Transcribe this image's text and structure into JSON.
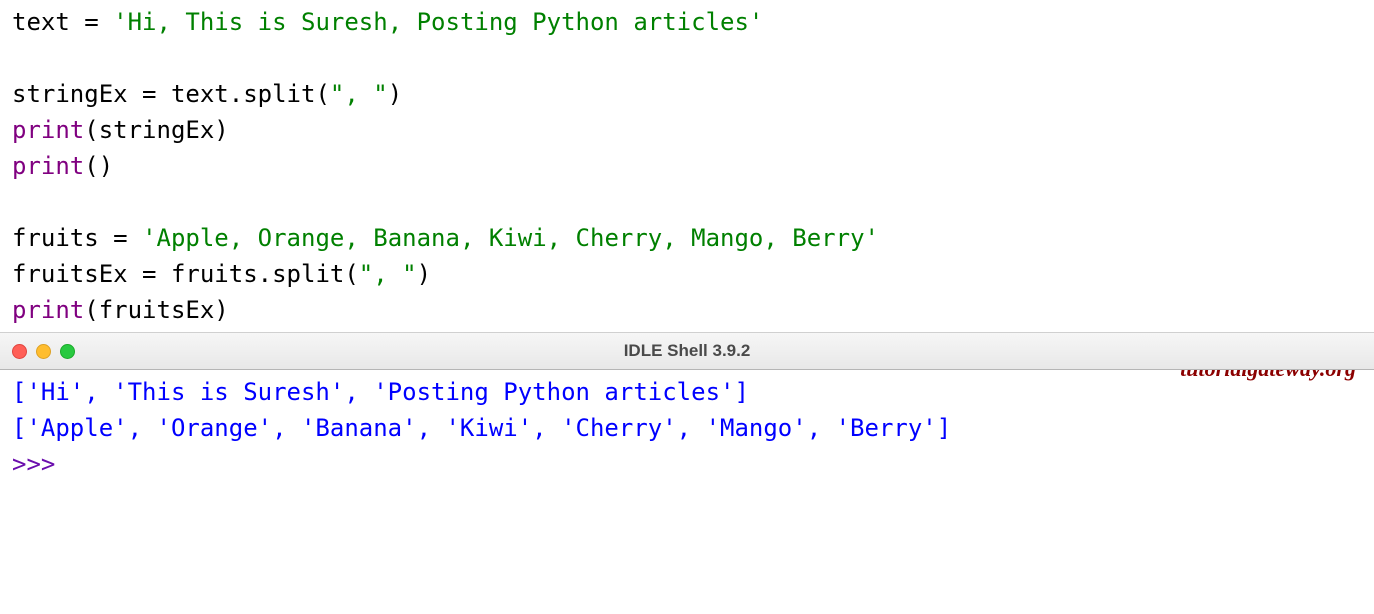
{
  "editor": {
    "line1": {
      "var": "text",
      "eq": " = ",
      "str": "'Hi, This is Suresh, Posting Python articles'"
    },
    "line3": {
      "var": "stringEx",
      "eq": " = ",
      "attr": "text.split(",
      "arg": "\", \"",
      "close": ")"
    },
    "line4": {
      "fn": "print",
      "open": "(",
      "arg": "stringEx",
      "close": ")"
    },
    "line5": {
      "fn": "print",
      "parens": "()"
    },
    "line7": {
      "var": "fruits",
      "eq": " = ",
      "str": "'Apple, Orange, Banana, Kiwi, Cherry, Mango, Berry'"
    },
    "line8": {
      "var": "fruitsEx",
      "eq": " = ",
      "attr": "fruits.split(",
      "arg": "\", \"",
      "close": ")"
    },
    "line9": {
      "fn": "print",
      "open": "(",
      "arg": "fruitsEx",
      "close": ")"
    }
  },
  "watermark": "tutorialgateway.org",
  "titlebar": {
    "title": "IDLE Shell 3.9.2"
  },
  "shell": {
    "out1": "['Hi', 'This is Suresh', 'Posting Python articles']",
    "out2": "",
    "out3": "['Apple', 'Orange', 'Banana', 'Kiwi', 'Cherry', 'Mango', 'Berry']",
    "prompt": ">>> "
  }
}
